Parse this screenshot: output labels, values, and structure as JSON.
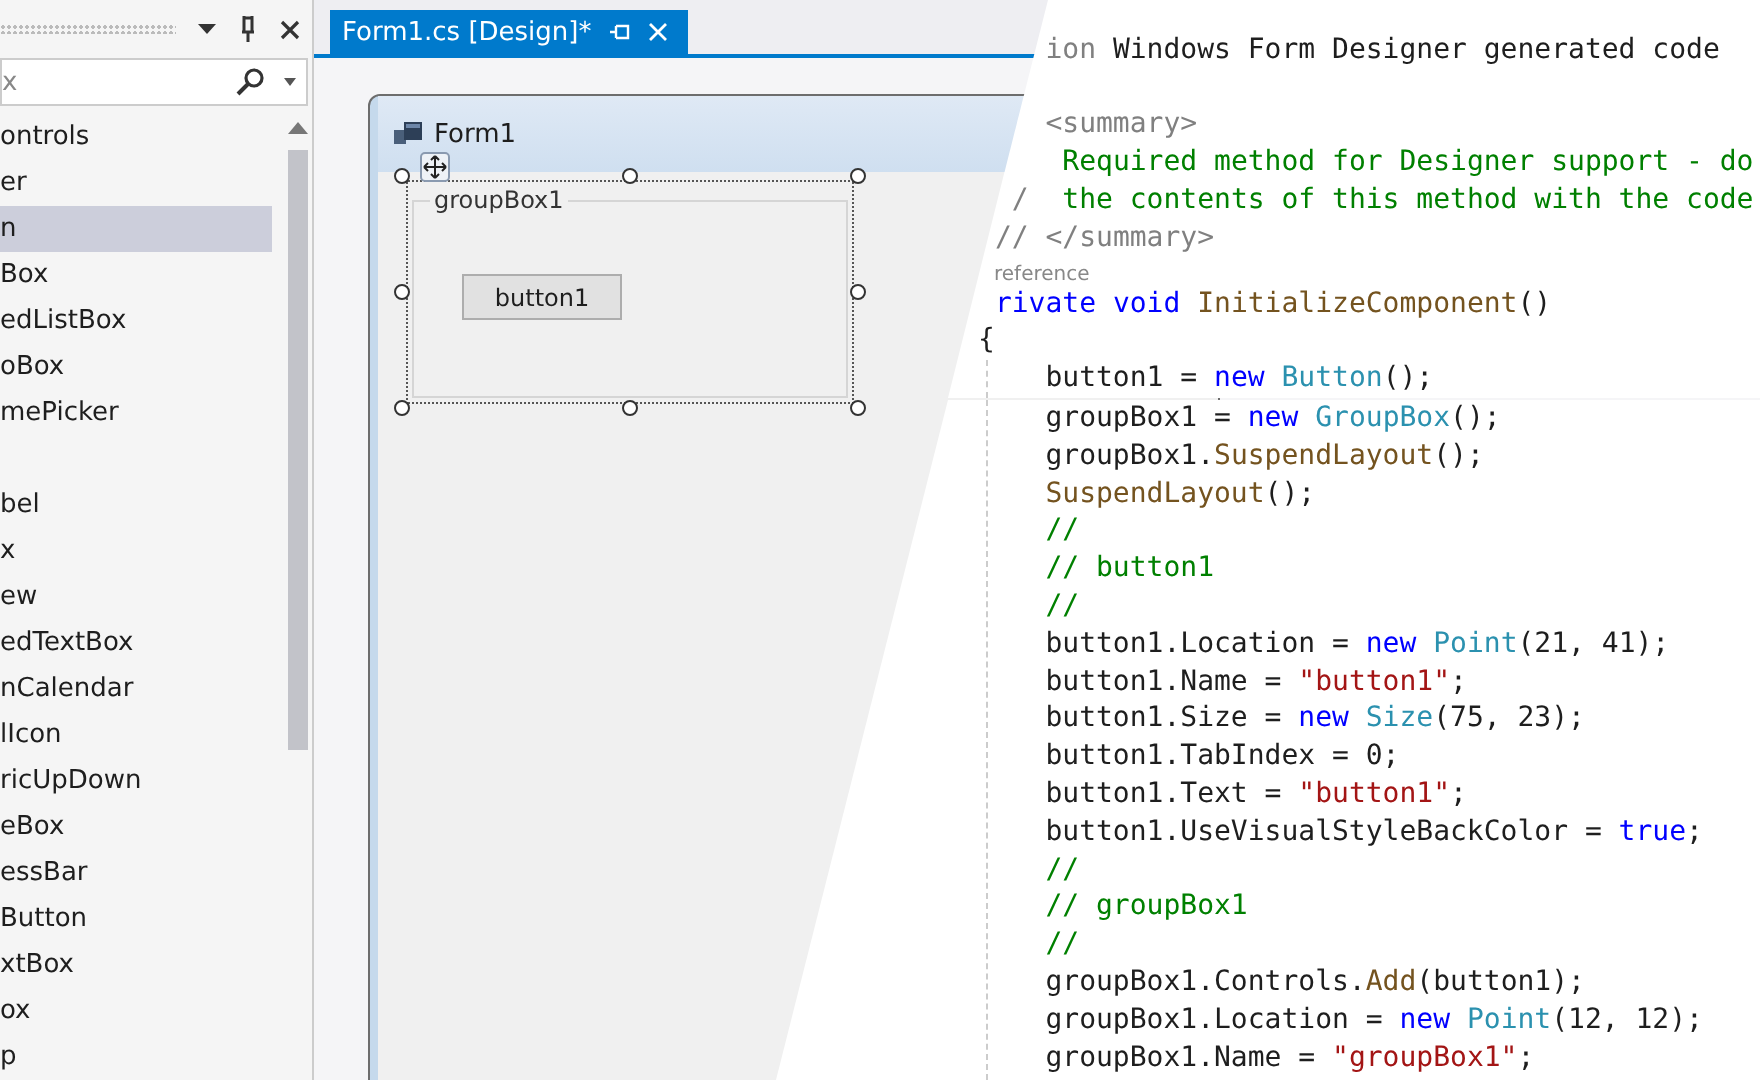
{
  "toolbox": {
    "search": {
      "placeholder": "x"
    },
    "items": [
      {
        "label": "ontrols",
        "selected": false
      },
      {
        "label": "er",
        "selected": false
      },
      {
        "label": "n",
        "selected": true
      },
      {
        "label": "Box",
        "selected": false
      },
      {
        "label": "edListBox",
        "selected": false
      },
      {
        "label": "oBox",
        "selected": false
      },
      {
        "label": "mePicker",
        "selected": false
      },
      {
        "selected": false
      },
      {
        "label": "bel",
        "selected": false
      },
      {
        "label": "x",
        "selected": false
      },
      {
        "label": "ew",
        "selected": false
      },
      {
        "label": "edTextBox",
        "selected": false
      },
      {
        "label": "nCalendar",
        "selected": false
      },
      {
        "label": "lIcon",
        "selected": false
      },
      {
        "label": "ricUpDown",
        "selected": false
      },
      {
        "label": "eBox",
        "selected": false
      },
      {
        "label": "essBar",
        "selected": false
      },
      {
        "label": "Button",
        "selected": false
      },
      {
        "label": "xtBox",
        "selected": false
      },
      {
        "label": "ox",
        "selected": false
      },
      {
        "label": "p",
        "selected": false
      }
    ]
  },
  "document_tab": {
    "title": "Form1.cs [Design]*",
    "selected": true
  },
  "form": {
    "title": "Form1",
    "group_box": {
      "text": "groupBox1",
      "selected": true
    },
    "button": {
      "text": "button1"
    }
  },
  "code": {
    "lines": [
      {
        "kind": "code",
        "segments": [
          {
            "text": "    ion",
            "kind": "preproc"
          },
          {
            "text": " Windows Form Designer generated code",
            "kind": "plain"
          }
        ]
      },
      {
        "kind": "blank"
      },
      {
        "kind": "code",
        "segments": [
          {
            "text": "    <summary>",
            "kind": "doc"
          }
        ]
      },
      {
        "kind": "code",
        "segments": [
          {
            "text": "     Required method for Designer support - do",
            "kind": "comment"
          }
        ]
      },
      {
        "kind": "code",
        "segments": [
          {
            "text": "  /",
            "kind": "doc"
          },
          {
            "text": "  the contents of this method with the code",
            "kind": "comment"
          }
        ]
      },
      {
        "kind": "code",
        "segments": [
          {
            "text": " // </summary>",
            "kind": "doc"
          }
        ]
      },
      {
        "kind": "codelens",
        "text": "reference"
      },
      {
        "kind": "code",
        "segments": [
          {
            "text": " rivate void",
            "kind": "keyword"
          },
          {
            "text": " InitializeComponent",
            "kind": "method"
          },
          {
            "text": "()",
            "kind": "plain"
          }
        ]
      },
      {
        "kind": "code",
        "segments": [
          {
            "text": "{",
            "kind": "plain"
          }
        ]
      },
      {
        "kind": "code",
        "segments": [
          {
            "text": "    button1 = ",
            "kind": "plain"
          },
          {
            "text": "new",
            "kind": "keyword"
          },
          {
            "text": " Button",
            "kind": "type"
          },
          {
            "text": "();",
            "kind": "plain"
          }
        ]
      },
      {
        "kind": "code",
        "segments": [
          {
            "text": "    groupBox1 = ",
            "kind": "plain"
          },
          {
            "text": "new",
            "kind": "keyword"
          },
          {
            "text": " GroupBox",
            "kind": "type"
          },
          {
            "text": "();",
            "kind": "plain"
          }
        ]
      },
      {
        "kind": "code",
        "segments": [
          {
            "text": "    groupBox1.",
            "kind": "plain"
          },
          {
            "text": "SuspendLayout",
            "kind": "method"
          },
          {
            "text": "();",
            "kind": "plain"
          }
        ]
      },
      {
        "kind": "code",
        "segments": [
          {
            "text": "    SuspendLayout",
            "kind": "method"
          },
          {
            "text": "();",
            "kind": "plain"
          }
        ]
      },
      {
        "kind": "code",
        "segments": [
          {
            "text": "    //",
            "kind": "comment"
          }
        ]
      },
      {
        "kind": "code",
        "segments": [
          {
            "text": "    // button1",
            "kind": "comment"
          }
        ]
      },
      {
        "kind": "code",
        "segments": [
          {
            "text": "    //",
            "kind": "comment"
          }
        ]
      },
      {
        "kind": "code",
        "segments": [
          {
            "text": "    button1.Location = ",
            "kind": "plain"
          },
          {
            "text": "new",
            "kind": "keyword"
          },
          {
            "text": " Point",
            "kind": "type"
          },
          {
            "text": "(21, 41);",
            "kind": "plain"
          }
        ]
      },
      {
        "kind": "code",
        "segments": [
          {
            "text": "    button1.Name = ",
            "kind": "plain"
          },
          {
            "text": "\"button1\"",
            "kind": "string"
          },
          {
            "text": ";",
            "kind": "plain"
          }
        ]
      },
      {
        "kind": "code",
        "segments": [
          {
            "text": "    button1.Size = ",
            "kind": "plain"
          },
          {
            "text": "new",
            "kind": "keyword"
          },
          {
            "text": " Size",
            "kind": "type"
          },
          {
            "text": "(75, 23);",
            "kind": "plain"
          }
        ]
      },
      {
        "kind": "code",
        "segments": [
          {
            "text": "    button1.TabIndex = 0;",
            "kind": "plain"
          }
        ]
      },
      {
        "kind": "code",
        "segments": [
          {
            "text": "    button1.Text = ",
            "kind": "plain"
          },
          {
            "text": "\"button1\"",
            "kind": "string"
          },
          {
            "text": ";",
            "kind": "plain"
          }
        ]
      },
      {
        "kind": "code",
        "segments": [
          {
            "text": "    button1.UseVisualStyleBackColor = ",
            "kind": "plain"
          },
          {
            "text": "true",
            "kind": "keyword"
          },
          {
            "text": ";",
            "kind": "plain"
          }
        ]
      },
      {
        "kind": "code",
        "segments": [
          {
            "text": "    //",
            "kind": "comment"
          }
        ]
      },
      {
        "kind": "code",
        "segments": [
          {
            "text": "    // groupBox1",
            "kind": "comment"
          }
        ]
      },
      {
        "kind": "code",
        "segments": [
          {
            "text": "    //",
            "kind": "comment"
          }
        ]
      },
      {
        "kind": "code",
        "segments": [
          {
            "text": "    groupBox1.Controls.",
            "kind": "plain"
          },
          {
            "text": "Add",
            "kind": "method"
          },
          {
            "text": "(button1);",
            "kind": "plain"
          }
        ]
      },
      {
        "kind": "code",
        "segments": [
          {
            "text": "    groupBox1.Location = ",
            "kind": "plain"
          },
          {
            "text": "new",
            "kind": "keyword"
          },
          {
            "text": " Point",
            "kind": "type"
          },
          {
            "text": "(12, 12);",
            "kind": "plain"
          }
        ]
      },
      {
        "kind": "code",
        "segments": [
          {
            "text": "    groupBox1.Name = ",
            "kind": "plain"
          },
          {
            "text": "\"groupBox1\"",
            "kind": "string"
          },
          {
            "text": ";",
            "kind": "plain"
          }
        ]
      }
    ]
  }
}
